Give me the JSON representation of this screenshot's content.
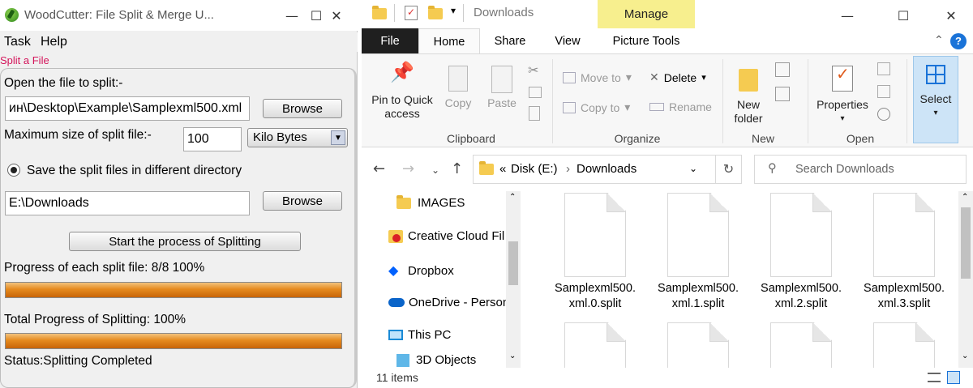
{
  "woodcutter": {
    "title": "WoodCutter: File Split & Merge U...",
    "menu": [
      "Task",
      "Help"
    ],
    "group_label": "Split a File",
    "open_label": "Open the file to split:-",
    "file_path": "ин\\Desktop\\Example\\Samplexml500.xml",
    "browse1": "Browse",
    "max_size_label": "Maximum size of split file:-",
    "max_size_value": "100",
    "unit_selected": "Kilo Bytes",
    "radio_label": "Save the split files in different directory",
    "dir_path": "E:\\Downloads",
    "browse2": "Browse",
    "start_button": "Start the process of Splitting",
    "progress_each_label": "Progress of each split file: 8/8 100%",
    "progress_each_percent": 100,
    "progress_total_label": "Total Progress of Splitting: 100%",
    "progress_total_percent": 100,
    "status": "Status:Splitting Completed"
  },
  "explorer": {
    "title": "Downloads",
    "manage_tab": "Manage",
    "tabs": [
      "File",
      "Home",
      "Share",
      "View",
      "Picture Tools"
    ],
    "clipboard": {
      "pin": "Pin to Quick access",
      "copy": "Copy",
      "paste": "Paste",
      "group": "Clipboard"
    },
    "organize": {
      "move_to": "Move to",
      "copy_to": "Copy to",
      "delete": "Delete",
      "rename": "Rename",
      "group": "Organize"
    },
    "new": {
      "new_folder": "New folder",
      "group": "New"
    },
    "open": {
      "properties": "Properties",
      "group": "Open"
    },
    "select": {
      "label": "Select"
    },
    "address": {
      "prefix": "«",
      "disk": "Disk (E:)",
      "folder": "Downloads"
    },
    "search_placeholder": "Search Downloads",
    "nav_items": [
      "IMAGES",
      "Creative Cloud Fil",
      "Dropbox",
      "OneDrive - Person",
      "This PC",
      "3D Objects"
    ],
    "files": [
      "Samplexml500.\nxml.0.split",
      "Samplexml500.\nxml.1.split",
      "Samplexml500.\nxml.2.split",
      "Samplexml500.\nxml.3.split"
    ],
    "status": "11 items"
  }
}
